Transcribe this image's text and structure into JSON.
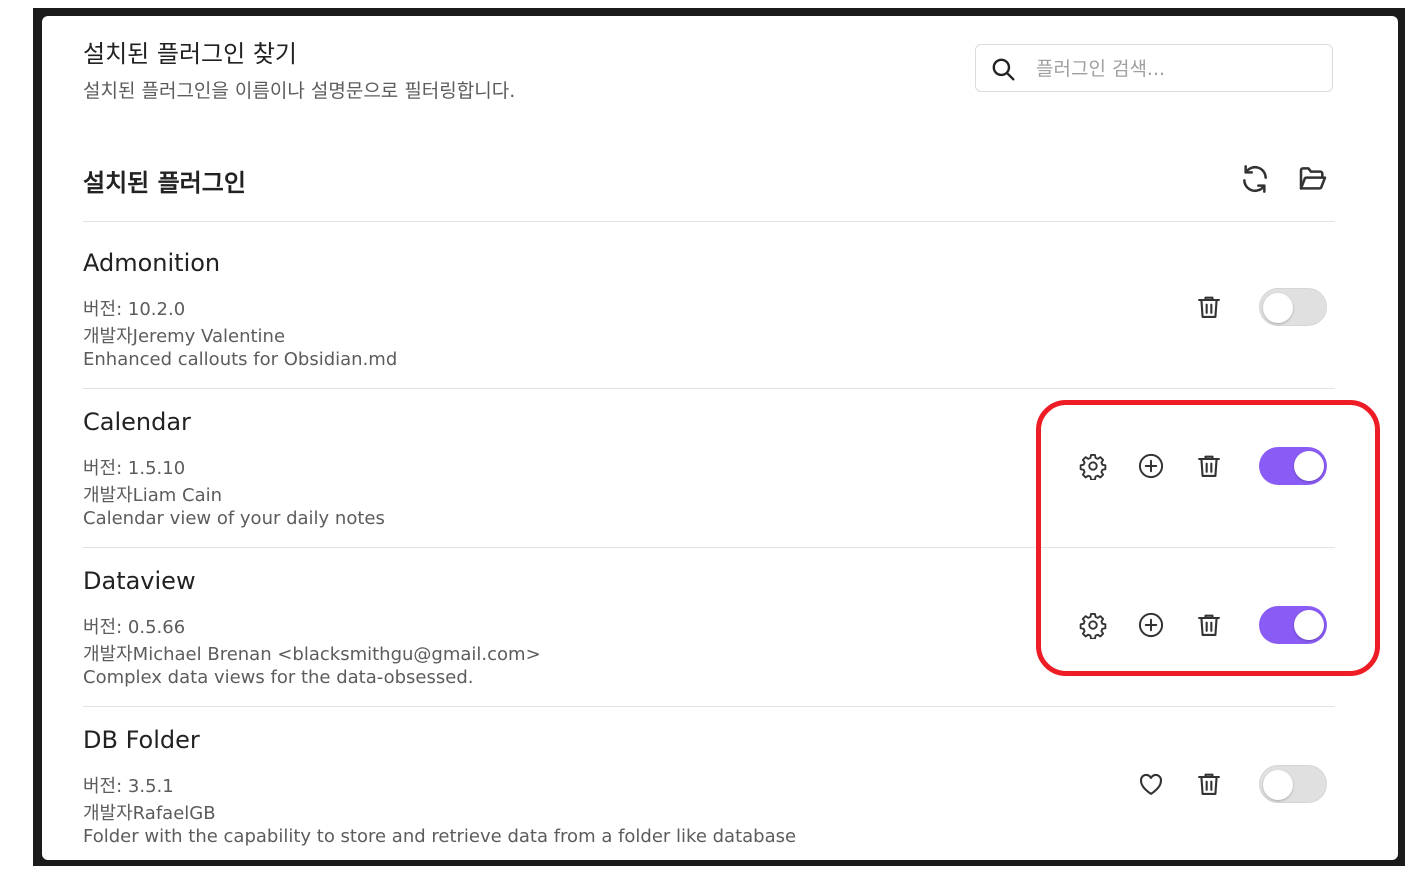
{
  "search": {
    "title": "설치된 플러그인 찾기",
    "description": "설치된 플러그인을 이름이나 설명문으로 필터링합니다.",
    "placeholder": "플러그인 검색..."
  },
  "section": {
    "title": "설치된 플러그인"
  },
  "plugins": [
    {
      "name": "Admonition",
      "version": "버전: 10.2.0",
      "author": "개발자Jeremy Valentine",
      "description": "Enhanced callouts for Obsidian.md",
      "enabled": false,
      "actions": [
        "trash-icon"
      ]
    },
    {
      "name": "Calendar",
      "version": "버전: 1.5.10",
      "author": "개발자Liam Cain",
      "description": "Calendar view of your daily notes",
      "enabled": true,
      "actions": [
        "gear-icon",
        "plus-circle-icon",
        "trash-icon"
      ]
    },
    {
      "name": "Dataview",
      "version": "버전: 0.5.66",
      "author": "개발자Michael Brenan <blacksmithgu@gmail.com>",
      "description": "Complex data views for the data-obsessed.",
      "enabled": true,
      "actions": [
        "gear-icon",
        "plus-circle-icon",
        "trash-icon"
      ]
    },
    {
      "name": "DB Folder",
      "version": "버전: 3.5.1",
      "author": "개발자RafaelGB",
      "description": "Folder with the capability to store and retrieve data from a folder like database",
      "enabled": false,
      "actions": [
        "heart-icon",
        "trash-icon"
      ]
    }
  ],
  "colors": {
    "accent": "#8a5cf5",
    "highlight": "#ee1c25"
  }
}
